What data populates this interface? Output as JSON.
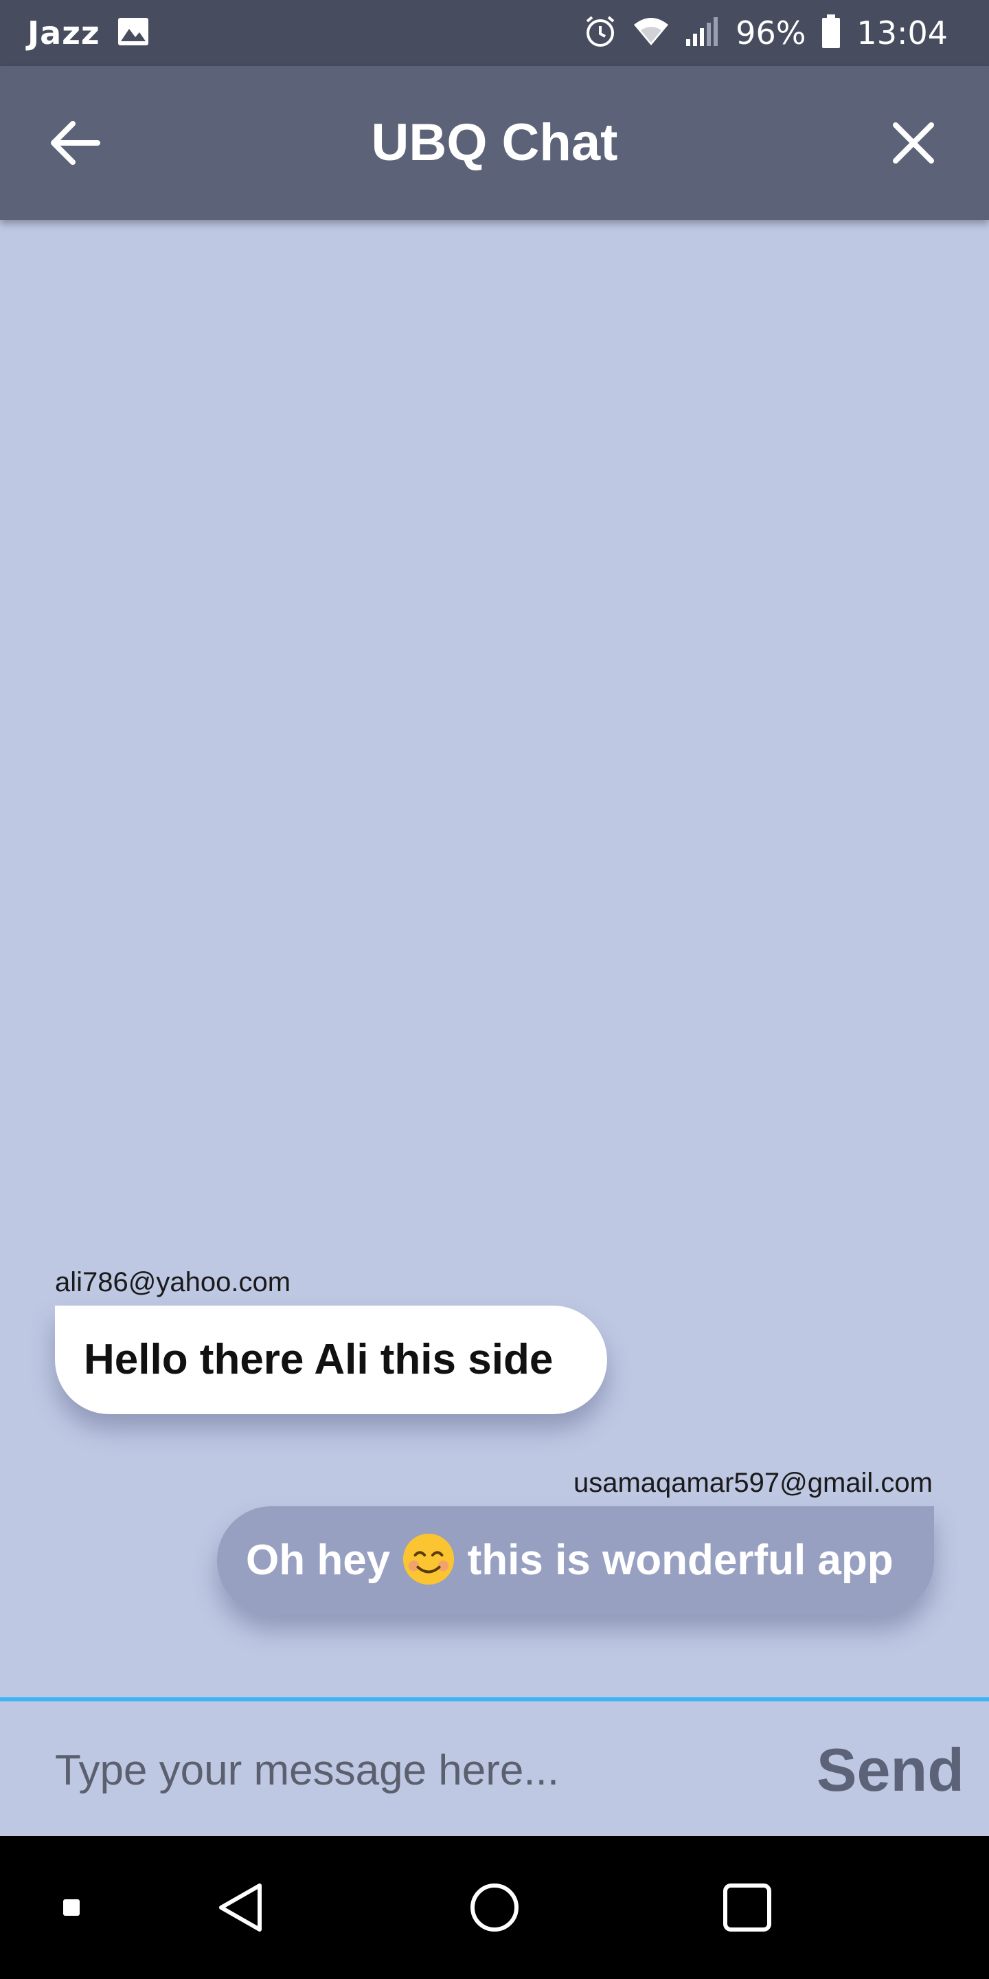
{
  "status_bar": {
    "carrier": "Jazz",
    "battery": "96%",
    "time": "13:04",
    "icons": [
      "image-icon",
      "alarm-icon",
      "wifi-icon",
      "signal-icon",
      "battery-icon"
    ]
  },
  "app_bar": {
    "title": "UBQ Chat",
    "back_icon": "arrow-left-icon",
    "close_icon": "close-icon"
  },
  "messages": [
    {
      "sender": "ali786@yahoo.com",
      "text": "Hello there Ali this side",
      "direction": "received"
    },
    {
      "sender": "usamaqamar597@gmail.com",
      "text_before_emoji": "Oh hey",
      "emoji": "smiling-face-emoji",
      "text_after_emoji": "this is wonderful app",
      "direction": "sent"
    }
  ],
  "composer": {
    "placeholder": "Type your message here...",
    "value": "",
    "send_label": "Send"
  },
  "nav_bar": {
    "icons": [
      "recents-dot-icon",
      "back-triangle-icon",
      "home-circle-icon",
      "overview-square-icon"
    ]
  },
  "colors": {
    "status_bar": "#474c5f",
    "app_bar": "#5c6378",
    "chat_background": "#bec8e3",
    "received_bubble": "#ffffff",
    "sent_bubble": "#98a0c2",
    "input_divider": "#3fb4f2"
  }
}
